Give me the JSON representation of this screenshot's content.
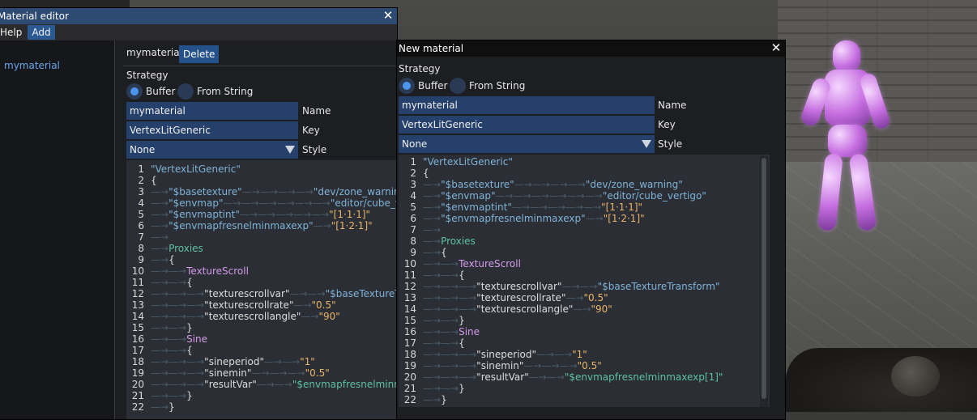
{
  "editor_window": {
    "title": "Material editor",
    "menu": [
      "Help",
      "Add"
    ],
    "sidebar_items": [
      "mymaterial"
    ],
    "material_name": "mymaterial",
    "delete_label": "Delete",
    "strategy_label": "Strategy",
    "radio_buffer": "Buffer",
    "radio_from_string": "From String",
    "name_value": "mymaterial",
    "name_label": "Name",
    "key_value": "VertexLitGeneric",
    "key_label": "Key",
    "style_value": "None",
    "style_label": "Style"
  },
  "new_window": {
    "title": "New material",
    "strategy_label": "Strategy",
    "radio_buffer": "Buffer",
    "radio_from_string": "From String",
    "name_value": "mymaterial",
    "name_label": "Name",
    "key_value": "VertexLitGeneric",
    "key_label": "Key",
    "style_value": "None",
    "style_label": "Style"
  },
  "code_lines": [
    {
      "n": "1",
      "parts": [
        [
          "k",
          "\"VertexLitGeneric\""
        ]
      ]
    },
    {
      "n": "2",
      "parts": [
        [
          "w",
          "{"
        ]
      ]
    },
    {
      "n": "3",
      "parts": [
        [
          "tab",
          "—→"
        ],
        [
          "k",
          "\"$basetexture\""
        ],
        [
          "tab",
          "—→—→—→—→"
        ],
        [
          "k",
          "\"dev/zone_warning\""
        ]
      ]
    },
    {
      "n": "4",
      "parts": [
        [
          "tab",
          "—→"
        ],
        [
          "k",
          "\"$envmap\""
        ],
        [
          "tab",
          "—→—→—→—→—→—→"
        ],
        [
          "k",
          "\"editor/cube_vertigo\""
        ]
      ]
    },
    {
      "n": "5",
      "parts": [
        [
          "tab",
          "—→"
        ],
        [
          "k",
          "\"$envmaptint\""
        ],
        [
          "tab",
          "—→—→—→—→—→"
        ],
        [
          "s",
          "\"[1·1·1]\""
        ]
      ]
    },
    {
      "n": "6",
      "parts": [
        [
          "tab",
          "—→"
        ],
        [
          "k",
          "\"$envmapfresnelminmaxexp\""
        ],
        [
          "tab",
          "—→"
        ],
        [
          "s",
          "\"[1·2·1]\""
        ]
      ]
    },
    {
      "n": "7",
      "parts": [
        [
          "tab",
          "—→"
        ]
      ]
    },
    {
      "n": "8",
      "parts": [
        [
          "tab",
          "—→"
        ],
        [
          "g",
          "Proxies"
        ]
      ]
    },
    {
      "n": "9",
      "parts": [
        [
          "tab",
          "—→"
        ],
        [
          "w",
          "{"
        ]
      ]
    },
    {
      "n": "10",
      "parts": [
        [
          "tab",
          "—→—→"
        ],
        [
          "p",
          "TextureScroll"
        ]
      ]
    },
    {
      "n": "11",
      "parts": [
        [
          "tab",
          "—→—→"
        ],
        [
          "w",
          "{"
        ]
      ]
    },
    {
      "n": "12",
      "parts": [
        [
          "tab",
          "—→—→—→"
        ],
        [
          "w",
          "\"texturescrollvar\""
        ],
        [
          "tab",
          "—→—→"
        ],
        [
          "k",
          "\"$baseTextureTransform\""
        ]
      ]
    },
    {
      "n": "13",
      "parts": [
        [
          "tab",
          "—→—→—→"
        ],
        [
          "w",
          "\"texturescrollrate\""
        ],
        [
          "tab",
          "—→"
        ],
        [
          "s",
          "\"0.5\""
        ]
      ]
    },
    {
      "n": "14",
      "parts": [
        [
          "tab",
          "—→—→—→"
        ],
        [
          "w",
          "\"texturescrollangle\""
        ],
        [
          "tab",
          "—→"
        ],
        [
          "s",
          "\"90\""
        ]
      ]
    },
    {
      "n": "15",
      "parts": [
        [
          "tab",
          "—→—→"
        ],
        [
          "w",
          "}"
        ]
      ]
    },
    {
      "n": "16",
      "parts": [
        [
          "tab",
          "—→—→"
        ],
        [
          "p",
          "Sine"
        ]
      ]
    },
    {
      "n": "17",
      "parts": [
        [
          "tab",
          "—→—→"
        ],
        [
          "w",
          "{"
        ]
      ]
    },
    {
      "n": "18",
      "parts": [
        [
          "tab",
          "—→—→—→"
        ],
        [
          "w",
          "\"sineperiod\""
        ],
        [
          "tab",
          "—→—→"
        ],
        [
          "s",
          "\"1\""
        ]
      ]
    },
    {
      "n": "19",
      "parts": [
        [
          "tab",
          "—→—→—→"
        ],
        [
          "w",
          "\"sinemin\""
        ],
        [
          "tab",
          "—→—→—→"
        ],
        [
          "s",
          "\"0.5\""
        ]
      ]
    },
    {
      "n": "20",
      "parts": [
        [
          "tab",
          "—→—→—→"
        ],
        [
          "w",
          "\"resultVar\""
        ],
        [
          "tab",
          "—→—→"
        ],
        [
          "g",
          "\"$envmapfresnelminmaxexp[1]\""
        ]
      ]
    },
    {
      "n": "21",
      "parts": [
        [
          "tab",
          "—→—→"
        ],
        [
          "w",
          "}"
        ]
      ]
    },
    {
      "n": "22",
      "parts": [
        [
          "tab",
          "—→"
        ],
        [
          "w",
          "}"
        ]
      ]
    }
  ]
}
